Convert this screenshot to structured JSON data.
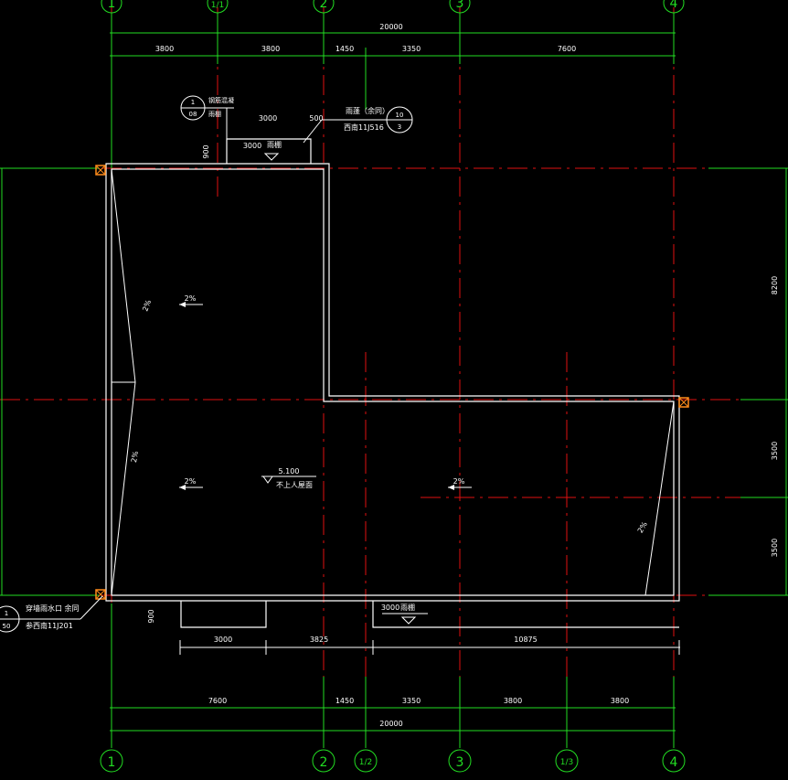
{
  "axes": {
    "vertical_top": [
      "1",
      "1/1",
      "2",
      "3",
      "4"
    ],
    "vertical_bottom": [
      "1",
      "2",
      "1/2",
      "3",
      "1/3",
      "4"
    ]
  },
  "dimensions": {
    "top_total": "20000",
    "top_segments": [
      "3800",
      "3800",
      "1450",
      "3350",
      "7600"
    ],
    "bottom_segments": [
      "7600",
      "1450",
      "3350",
      "3800",
      "3800"
    ],
    "bottom_total": "20000",
    "canopy_lower": [
      "3000",
      "3825",
      "10875"
    ],
    "right_side": [
      "8200",
      "3500",
      "3500"
    ],
    "canopy_upper_width": "3000",
    "canopy_offset": "500",
    "canopy_depth_upper": "900",
    "canopy_depth_lower": "900"
  },
  "labels": {
    "canopy_upper": "雨棚",
    "canopy_upper_dim": "3000",
    "canopy_lower": "雨棚",
    "canopy_lower_dim": "3000",
    "slope": "2%",
    "roof_elev": "5.100",
    "roof_note": "不上人屋面"
  },
  "callouts": {
    "detail_top": {
      "num": "1",
      "sheet": "08",
      "line1": "钢筋混凝",
      "line2": "雨棚"
    },
    "detail_right": {
      "num": "10",
      "sheet": "3",
      "line1": "雨蓬（余同）",
      "line2": "西南11J516"
    },
    "detail_left": {
      "num": "1",
      "sheet": "50",
      "line1": "穿墙雨水口 余同",
      "line2": "参西南11J201"
    }
  },
  "colors": {
    "background": "#000000",
    "grid": "#e01010",
    "dimension": "#22dd22",
    "wall": "#ffffff",
    "drain": "#ff8c1a"
  }
}
